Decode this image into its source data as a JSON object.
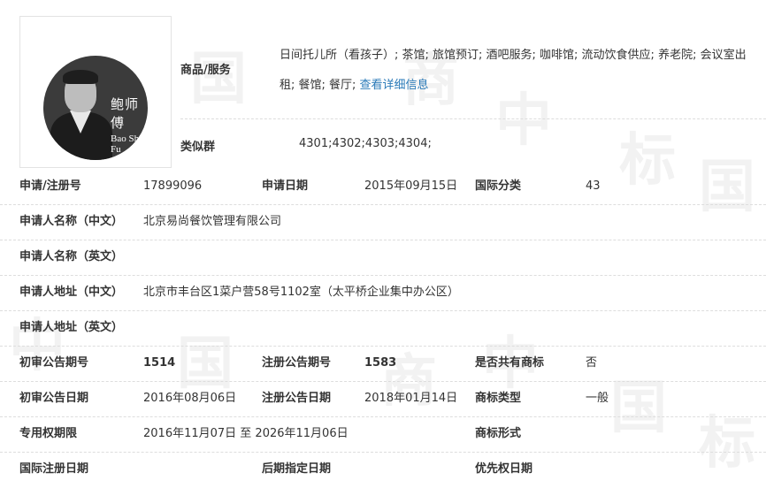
{
  "watermark": [
    "中",
    "国",
    "商",
    "标"
  ],
  "logo": {
    "name_cn": "鲍师傅",
    "name_en": "Bao Shi Fu"
  },
  "goods": {
    "label": "商品/服务",
    "text": "日间托儿所（看孩子）; 茶馆; 旅馆预订; 酒吧服务; 咖啡馆; 流动饮食供应; 养老院; 会议室出租; 餐馆; 餐厅;",
    "link": "查看详细信息"
  },
  "similar_group": {
    "label": "类似群",
    "value": "4301;4302;4303;4304;"
  },
  "rows": [
    {
      "cells": [
        {
          "label": "申请/注册号",
          "value": "17899096"
        },
        {
          "label": "申请日期",
          "value": "2015年09月15日"
        },
        {
          "label": "国际分类",
          "value": "43"
        }
      ]
    },
    {
      "cells": [
        {
          "label": "申请人名称（中文）",
          "value": "北京易尚餐饮管理有限公司"
        }
      ]
    },
    {
      "cells": [
        {
          "label": "申请人名称（英文）",
          "value": ""
        }
      ]
    },
    {
      "cells": [
        {
          "label": "申请人地址（中文）",
          "value": "北京市丰台区1菜户营58号1102室（太平桥企业集中办公区）"
        }
      ]
    },
    {
      "cells": [
        {
          "label": "申请人地址（英文）",
          "value": ""
        }
      ]
    },
    {
      "cells": [
        {
          "label": "初审公告期号",
          "value": "1514"
        },
        {
          "label": "注册公告期号",
          "value": "1583"
        },
        {
          "label": "是否共有商标",
          "value": "否"
        }
      ]
    },
    {
      "cells": [
        {
          "label": "初审公告日期",
          "value": "2016年08月06日"
        },
        {
          "label": "注册公告日期",
          "value": "2018年01月14日"
        },
        {
          "label": "商标类型",
          "value": "一般"
        }
      ]
    },
    {
      "cells": [
        {
          "label": "专用权期限",
          "value": "2016年11月07日 至 2026年11月06日"
        },
        {
          "label": "",
          "value": ""
        },
        {
          "label": "商标形式",
          "value": ""
        }
      ]
    },
    {
      "cells": [
        {
          "label": "国际注册日期",
          "value": ""
        },
        {
          "label": "后期指定日期",
          "value": ""
        },
        {
          "label": "优先权日期",
          "value": ""
        }
      ]
    }
  ]
}
